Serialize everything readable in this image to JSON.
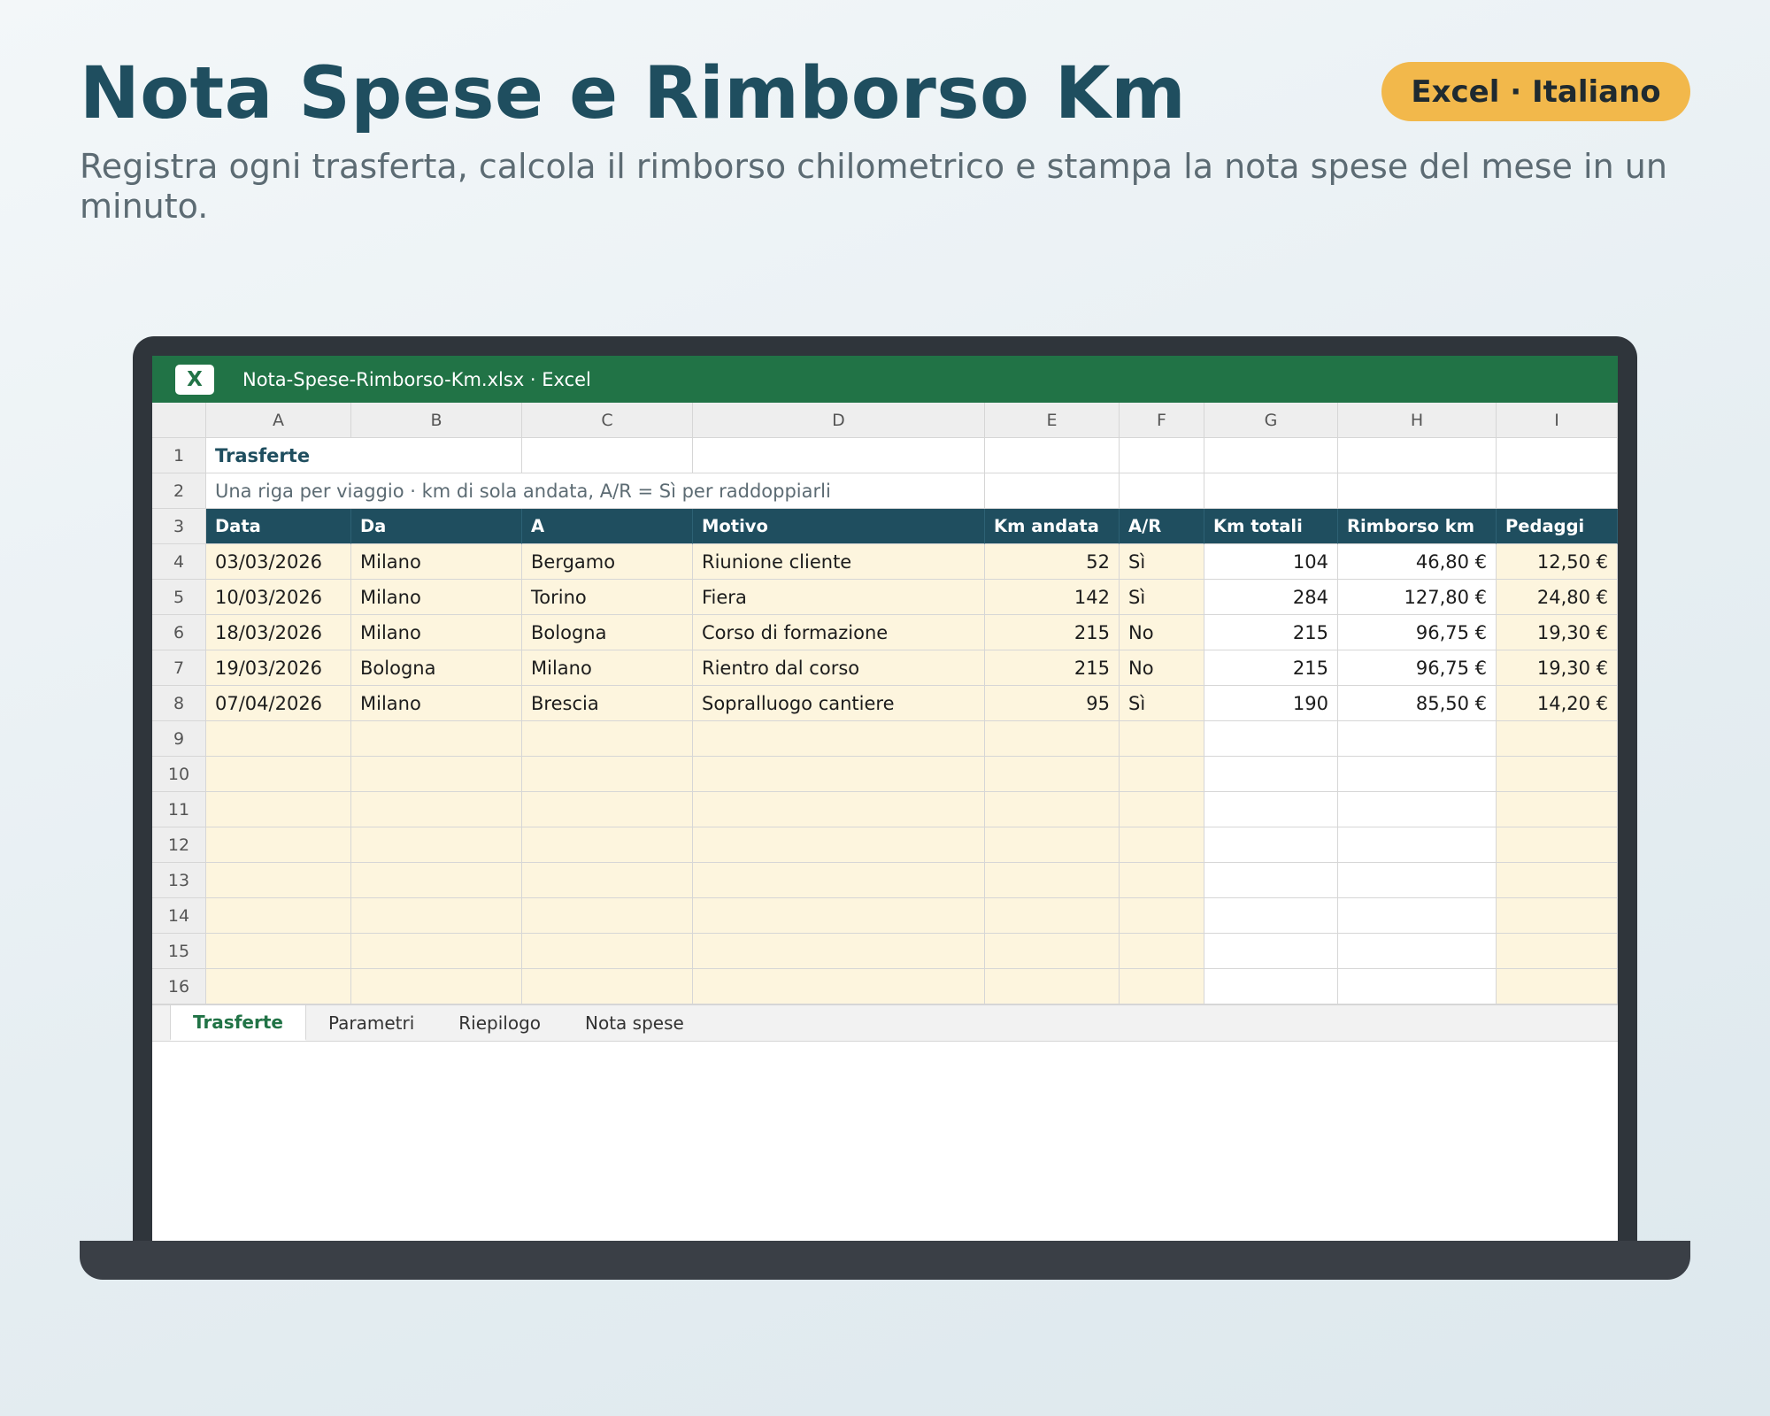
{
  "hero": {
    "title": "Nota Spese e Rimborso Km",
    "subtitle": "Registra ogni trasferta, calcola il rimborso chilometrico e stampa la nota spese del mese in un minuto.",
    "badge": "Excel · Italiano"
  },
  "window": {
    "app_icon_label": "X",
    "file_title": "Nota-Spese-Rimborso-Km.xlsx · Excel"
  },
  "sheet": {
    "columns": [
      "A",
      "B",
      "C",
      "D",
      "E",
      "F",
      "G",
      "H",
      "I"
    ],
    "section_title": "Trasferte",
    "note": "Una riga per viaggio · km di sola andata, A/R = Sì per raddoppiarli",
    "headers": [
      "Data",
      "Da",
      "A",
      "Motivo",
      "Km andata",
      "A/R",
      "Km totali",
      "Rimborso km",
      "Pedaggi"
    ],
    "rows": [
      [
        "03/03/2026",
        "Milano",
        "Bergamo",
        "Riunione cliente",
        "52",
        "Sì",
        "104",
        "46,80 €",
        "12,50 €"
      ],
      [
        "10/03/2026",
        "Milano",
        "Torino",
        "Fiera",
        "142",
        "Sì",
        "284",
        "127,80 €",
        "24,80 €"
      ],
      [
        "18/03/2026",
        "Milano",
        "Bologna",
        "Corso di formazione",
        "215",
        "No",
        "215",
        "96,75 €",
        "19,30 €"
      ],
      [
        "19/03/2026",
        "Bologna",
        "Milano",
        "Rientro dal corso",
        "215",
        "No",
        "215",
        "96,75 €",
        "19,30 €"
      ],
      [
        "07/04/2026",
        "Milano",
        "Brescia",
        "Sopralluogo cantiere",
        "95",
        "Sì",
        "190",
        "85,50 €",
        "14,20 €"
      ]
    ],
    "row_numbers": [
      "1",
      "2",
      "3",
      "4",
      "5",
      "6",
      "7",
      "8",
      "9",
      "10",
      "11",
      "12",
      "13",
      "14",
      "15",
      "16"
    ]
  },
  "tabs": [
    {
      "label": "Trasferte",
      "active": true
    },
    {
      "label": "Parametri",
      "active": false
    },
    {
      "label": "Riepilogo",
      "active": false
    },
    {
      "label": "Nota spese",
      "active": false
    }
  ],
  "colors": {
    "title": "#1f4e5f",
    "badge": "#f2b84b",
    "excel_green": "#217346",
    "header_fill": "#1f4e5f",
    "input_fill": "#fdf5de"
  }
}
